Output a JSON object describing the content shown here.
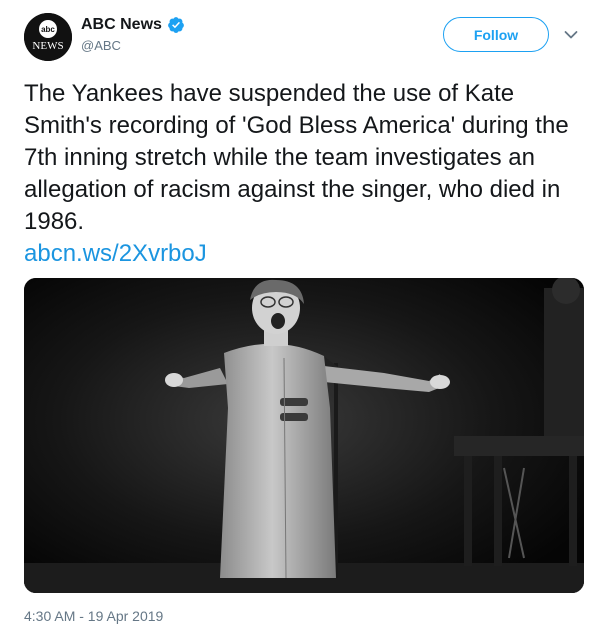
{
  "author": {
    "display_name": "ABC News",
    "handle": "@ABC",
    "verified": true,
    "avatar_icon": "abc-news-logo",
    "avatar_logo_text": "abc",
    "avatar_logo_subtext": "NEWS"
  },
  "actions": {
    "follow_label": "Follow",
    "menu_icon": "chevron-down-icon"
  },
  "tweet": {
    "text": "The Yankees have suspended the use of Kate Smith's recording of 'God Bless America' during the 7th inning stretch while the team investigates an allegation of racism against the singer, who died in 1986.",
    "link": "abcn.ws/2XvrboJ",
    "timestamp": "4:30 AM - 19 Apr 2019"
  },
  "colors": {
    "accent": "#1da1f2",
    "link": "#1b95e0",
    "text": "#14171a",
    "muted": "#657786"
  }
}
